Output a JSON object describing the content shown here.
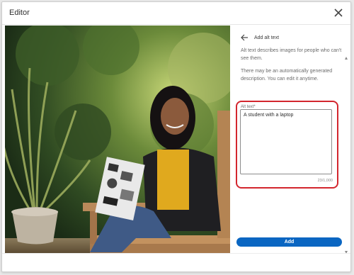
{
  "dialog": {
    "title": "Editor",
    "close_icon": "close-icon"
  },
  "photo": {
    "description_icon": "photo-image"
  },
  "panel": {
    "back_icon": "arrow-left-icon",
    "title": "Add alt text",
    "desc1": "Alt text describes images for people who can't see them.",
    "desc2": "There may be an automatically generated description. You can edit it anytime.",
    "field_label": "Alt text*",
    "field_value": "A student with a laptop",
    "counter": "23/1,000",
    "add_label": "Add"
  },
  "colors": {
    "accent": "#0a66c2",
    "highlight": "#d3262e"
  }
}
